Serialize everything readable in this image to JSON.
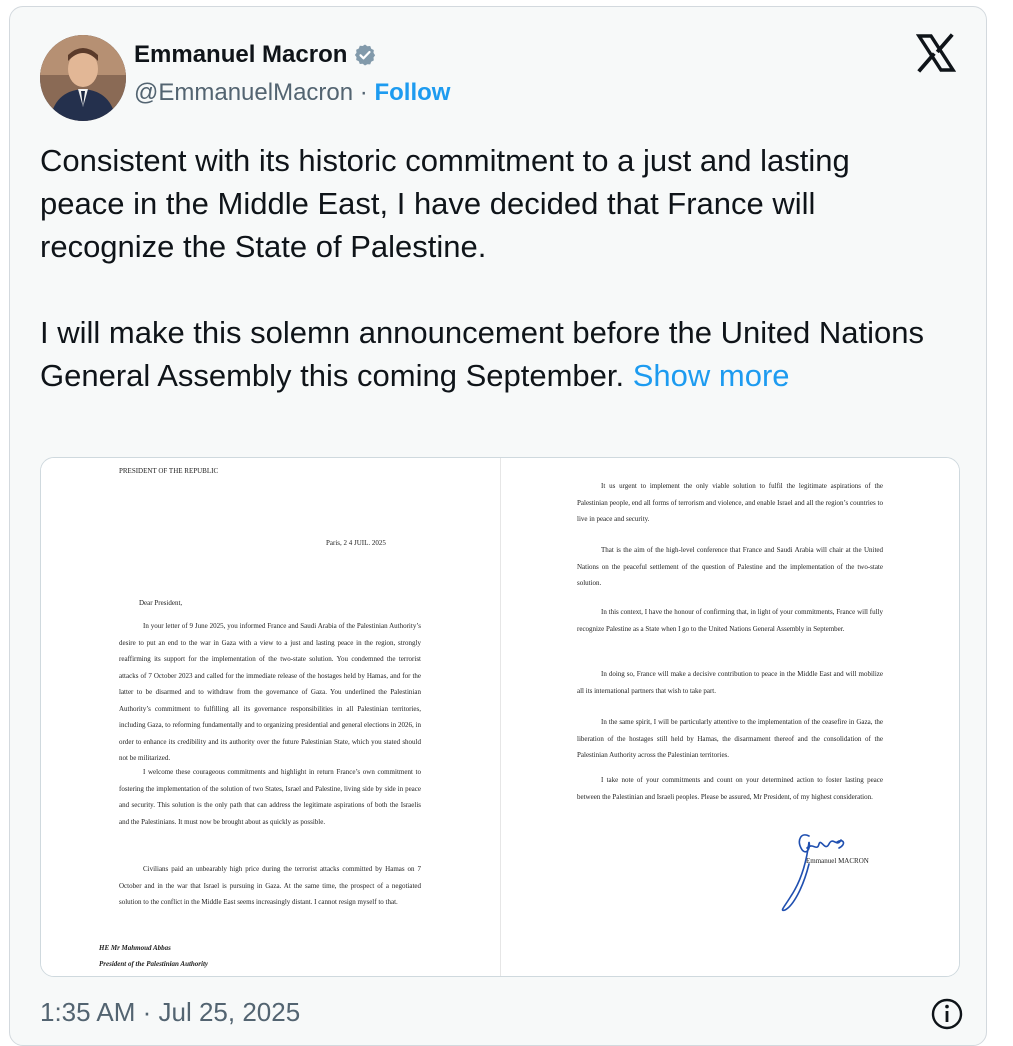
{
  "author": {
    "name": "Emmanuel Macron",
    "handle": "@EmmanuelMacron",
    "separator": "·",
    "follow_label": "Follow"
  },
  "tweet": {
    "text": "Consistent with its historic commitment to a just and lasting peace in the Middle East, I have decided that France will recognize the State of Palestine.\n\nI will make this solemn announcement before the United Nations General Assembly this coming September. ",
    "show_more": "Show more"
  },
  "letter": {
    "left": {
      "letterhead": "PRESIDENT OF THE REPUBLIC",
      "date": "Paris,  2 4 JUIL. 2025",
      "salutation": "Dear President,",
      "p1": "In your letter of 9 June 2025, you informed France and Saudi Arabia of the Palestinian Authority’s desire to put an end to the war in Gaza with a view to a just and lasting peace in the region, strongly reaffirming its support for the implementation of the two-state solution. You condemned the terrorist attacks of 7 October 2023 and called for the immediate release of the hostages held by Hamas, and for the latter to be disarmed and to withdraw from the governance of Gaza. You underlined the Palestinian Authority’s commitment to fulfilling all its governance responsibilities in all Palestinian territories, including Gaza, to reforming fundamentally and to organizing presidential and general elections in 2026, in order to enhance its credibility and its authority over the future Palestinian State, which you stated should not be militarized.",
      "p2": "I welcome these courageous commitments and highlight in return France’s own commitment to fostering the implementation of the solution of two States, Israel and Palestine, living side by side in peace and security. This solution is the only path that can address the legitimate aspirations of both the Israelis and the Palestinians. It must now be brought about as quickly as possible.",
      "p3": "Civilians paid an unbearably high price during the terrorist attacks committed by Hamas on 7 October and in the war that Israel is pursuing in Gaza. At the same time, the prospect of a negotiated solution to the conflict in the Middle East seems increasingly distant. I cannot resign myself to that.",
      "recipient_name": "HE Mr Mahmoud Abbas",
      "recipient_title": "President of the Palestinian Authority"
    },
    "right": {
      "p1": "It us urgent to implement the only viable solution to fulfil the legitimate aspirations of the Palestinian people, end all forms of terrorism and violence, and enable Israel and all the region’s countries to live in peace and security.",
      "p2": "That is the aim of the high-level conference that France and Saudi Arabia will chair at the United Nations on the peaceful settlement of the question of Palestine and the implementation of the two-state solution.",
      "p3": "In this context, I have the honour of confirming that, in light of your commitments, France will fully recognize Palestine as a State when I go to the United Nations General Assembly in September.",
      "p4": "In doing so, France will make a decisive contribution to peace in the Middle East and will mobilize all its international partners that wish to take part.",
      "p5": "In the same spirit, I will be particularly attentive to the implementation of the ceasefire in Gaza, the liberation of the hostages still held by Hamas, the disarmament thereof and the consolidation of the Palestinian Authority across the Palestinian territories.",
      "p6": "I take note of your commitments and count on your determined action to foster lasting peace between the Palestinian and Israeli peoples. Please be assured, Mr President, of my highest consideration.",
      "signature_name": "Emmanuel MACRON"
    }
  },
  "footer": {
    "timestamp": "1:35 AM · Jul 25, 2025"
  },
  "colors": {
    "accent": "#1d9bf0",
    "text": "#0f1419",
    "muted": "#536471",
    "signature_ink": "#1f4fb0"
  },
  "icons": [
    "verified-badge-icon",
    "x-logo-icon",
    "info-icon"
  ]
}
